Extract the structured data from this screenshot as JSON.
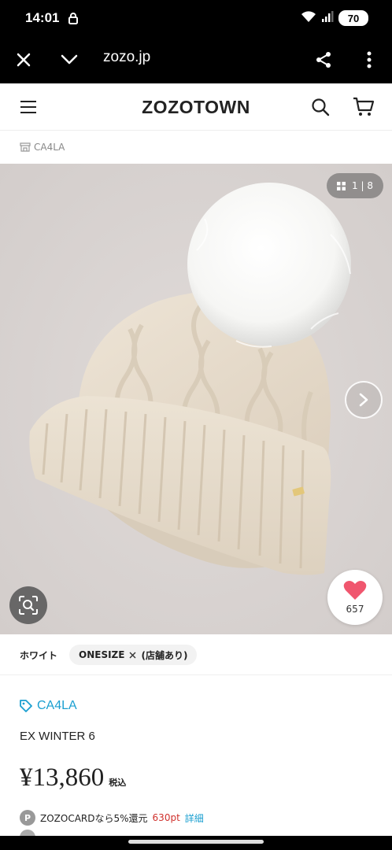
{
  "status": {
    "time": "14:01",
    "battery": "70"
  },
  "browser": {
    "url": "zozo.jp"
  },
  "site": {
    "logo": "ZOZOTOWN"
  },
  "breadcrumb": {
    "shop": "CA4LA"
  },
  "gallery": {
    "counter_current": "1",
    "counter_total": "8",
    "likes": "657"
  },
  "variant": {
    "color": "ホワイト",
    "size": "ONESIZE",
    "stock": "(店舗あり)"
  },
  "product": {
    "brand": "CA4LA",
    "name": "EX WINTER 6",
    "price": "¥13,860",
    "tax_label": "税込",
    "card_text": "ZOZOCARDなら5%還元",
    "card_points": "630pt",
    "card_detail": "詳細"
  },
  "colors": {
    "brand_blue": "#1a9fd0",
    "points_red": "#d0312d",
    "like_pink": "#f0566e"
  }
}
